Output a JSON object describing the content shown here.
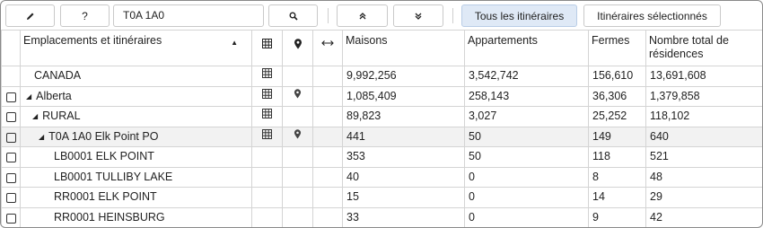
{
  "toolbar": {
    "help_label": "?",
    "search_value": "T0A 1A0",
    "all_routes_label": "Tous les itinéraires",
    "selected_routes_label": "Itinéraires sélectionnés",
    "icons": [
      "pencil-icon",
      "search-icon",
      "chevrons-up-icon",
      "chevrons-down-icon"
    ]
  },
  "table": {
    "headers": {
      "locations": "Emplacements et itinéraires",
      "houses": "Maisons",
      "apartments": "Appartements",
      "farms": "Fermes",
      "total": "Nombre total de résidences"
    },
    "header_icons": [
      "grid-icon",
      "map-pin-icon",
      "horizontal-arrows-icon"
    ],
    "rows": [
      {
        "name": "CANADA",
        "houses": "9,992,256",
        "apartments": "3,542,742",
        "farms": "156,610",
        "total": "13,691,608"
      },
      {
        "name": "Alberta",
        "houses": "1,085,409",
        "apartments": "258,143",
        "farms": "36,306",
        "total": "1,379,858"
      },
      {
        "name": "RURAL",
        "houses": "89,823",
        "apartments": "3,027",
        "farms": "25,252",
        "total": "118,102"
      },
      {
        "name": "T0A 1A0 Elk Point PO",
        "houses": "441",
        "apartments": "50",
        "farms": "149",
        "total": "640"
      },
      {
        "name": "LB0001 ELK POINT",
        "houses": "353",
        "apartments": "50",
        "farms": "118",
        "total": "521"
      },
      {
        "name": "LB0001 TULLIBY LAKE",
        "houses": "40",
        "apartments": "0",
        "farms": "8",
        "total": "48"
      },
      {
        "name": "RR0001 ELK POINT",
        "houses": "15",
        "apartments": "0",
        "farms": "14",
        "total": "29"
      },
      {
        "name": "RR0001 HEINSBURG",
        "houses": "33",
        "apartments": "0",
        "farms": "9",
        "total": "42"
      }
    ]
  }
}
